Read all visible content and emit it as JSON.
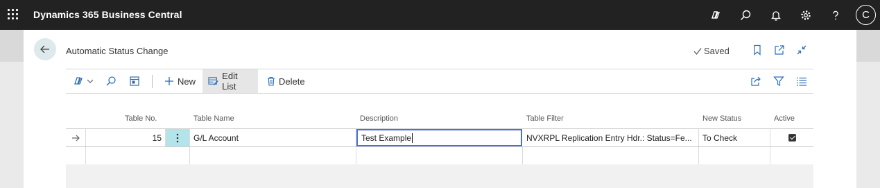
{
  "app": {
    "title": "Dynamics 365 Business Central",
    "user_initial": "C",
    "icons": [
      "waffle-icon",
      "copilot-icon",
      "search-icon",
      "bell-icon",
      "gear-icon",
      "help-icon"
    ]
  },
  "page": {
    "title": "Automatic Status Change",
    "saved_label": "Saved",
    "icons": [
      "back-arrow-icon",
      "checkmark-icon",
      "bookmark-icon",
      "open-new-window-icon",
      "collapse-icon"
    ]
  },
  "actions": {
    "new_label": "New",
    "edit_list_label": "Edit List",
    "delete_label": "Delete",
    "icons": [
      "copilot-icon",
      "search-icon",
      "filter-pane-icon",
      "share-icon",
      "filter-icon",
      "list-view-icon"
    ]
  },
  "table": {
    "columns": {
      "table_no": "Table No.",
      "table_name": "Table Name",
      "description": "Description",
      "table_filter": "Table Filter",
      "new_status": "New Status",
      "active": "Active"
    },
    "rows": [
      {
        "table_no": "15",
        "table_name": "G/L Account",
        "description": "Test Example",
        "table_filter": "NVXRPL Replication Entry Hdr.: Status=Fe...",
        "new_status": "To Check",
        "active": true
      }
    ]
  },
  "colors": {
    "topbar": "#222222",
    "accent": "#4a6ee0",
    "selection": "#b3e4ea"
  }
}
